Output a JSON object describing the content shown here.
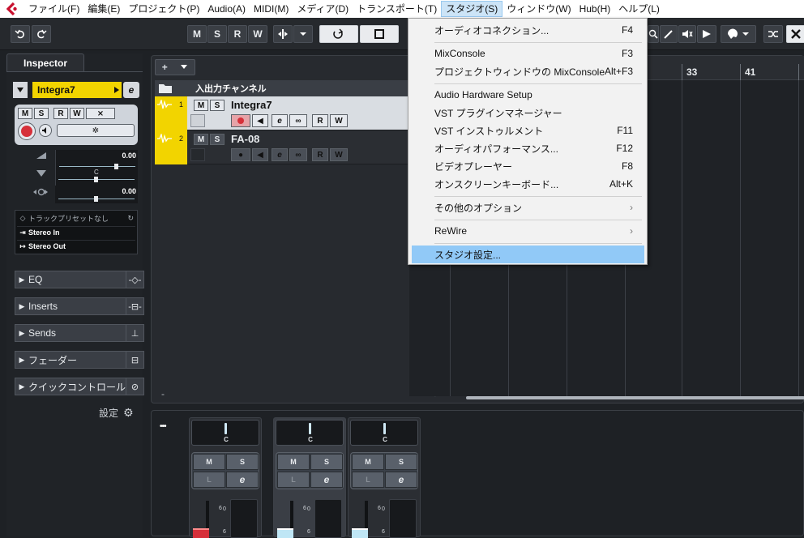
{
  "menubar": {
    "items": [
      "ファイル(F)",
      "編集(E)",
      "プロジェクト(P)",
      "Audio(A)",
      "MIDI(M)",
      "メディア(D)",
      "トランスポート(T)",
      "スタジオ(S)",
      "ウィンドウ(W)",
      "Hub(H)",
      "ヘルプ(L)"
    ],
    "active_index": 7
  },
  "toolbar": {
    "m": "M",
    "s": "S",
    "r": "R",
    "w": "W"
  },
  "inspector": {
    "tab": "Inspector",
    "track_name": "Integra7",
    "volume": "0.00",
    "pan_label": "C",
    "delay": "0.00",
    "preset": "トラックプリセットなし",
    "input": "Stereo In",
    "output": "Stereo Out",
    "sections": [
      "EQ",
      "Inserts",
      "Sends",
      "フェーダー",
      "クイックコントロール"
    ],
    "settings": "設定"
  },
  "project": {
    "folder_label": "入出力チャンネル",
    "tracks": [
      {
        "num": "1",
        "name": "Integra7"
      },
      {
        "num": "2",
        "name": "FA-08"
      }
    ],
    "ruler_marks": [
      "33",
      "41"
    ],
    "btn_m": "M",
    "btn_s": "S",
    "btn_r": "R",
    "btn_w": "W"
  },
  "mixer": {
    "dots": "•••",
    "pan_label": "C",
    "m": "M",
    "s": "S",
    "l": "L",
    "scale_6": "6",
    "scale_0": "0"
  },
  "dropdown": {
    "items": [
      {
        "label": "オーディオコネクション...",
        "shortcut": "F4"
      },
      {
        "label": "MixConsole",
        "shortcut": "F3"
      },
      {
        "label": "プロジェクトウィンドウの MixConsole",
        "shortcut": "Alt+F3"
      },
      {
        "label": "Audio Hardware Setup",
        "shortcut": ""
      },
      {
        "label": "VST プラグインマネージャー",
        "shortcut": ""
      },
      {
        "label": "VST インストゥルメント",
        "shortcut": "F11"
      },
      {
        "label": "オーディオパフォーマンス...",
        "shortcut": "F12"
      },
      {
        "label": "ビデオプレーヤー",
        "shortcut": "F8"
      },
      {
        "label": "オンスクリーンキーボード...",
        "shortcut": "Alt+K"
      },
      {
        "label": "その他のオプション",
        "shortcut": "›"
      },
      {
        "label": "ReWire",
        "shortcut": "›"
      },
      {
        "label": "スタジオ設定...",
        "shortcut": ""
      }
    ],
    "highlight_index": 11
  },
  "colors": {
    "track": "#f2d400",
    "accent": "#91c9f7",
    "record": "#d6303a"
  }
}
